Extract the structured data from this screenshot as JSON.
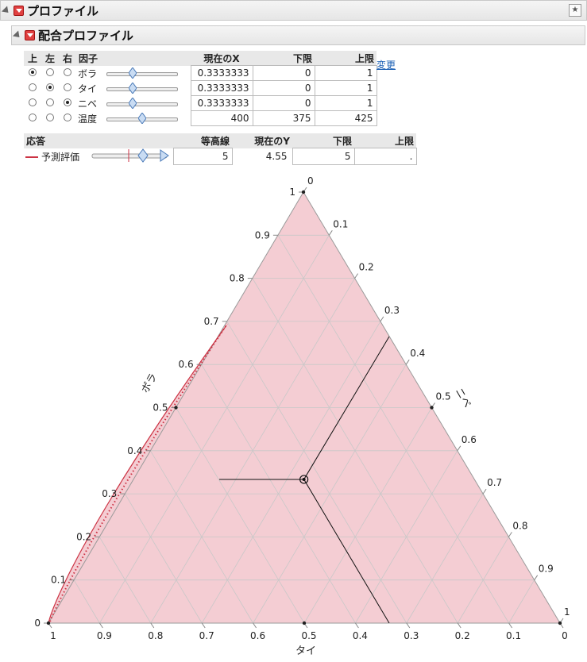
{
  "header_main": {
    "title": "プロファイル"
  },
  "header_sub": {
    "title": "配合プロファイル"
  },
  "factor_table": {
    "columns": [
      "上",
      "左",
      "右",
      "因子",
      "現在のX",
      "下限",
      "上限"
    ],
    "rows": [
      {
        "name": "ボラ",
        "current": "0.3333333",
        "low": "0",
        "high": "1",
        "top": true,
        "left": false,
        "right": false,
        "slider": 0.333
      },
      {
        "name": "タイ",
        "current": "0.3333333",
        "low": "0",
        "high": "1",
        "top": false,
        "left": true,
        "right": false,
        "slider": 0.333
      },
      {
        "name": "ニベ",
        "current": "0.3333333",
        "low": "0",
        "high": "1",
        "top": false,
        "left": false,
        "right": true,
        "slider": 0.333
      },
      {
        "name": "温度",
        "current": "400",
        "low": "375",
        "high": "425",
        "top": false,
        "left": false,
        "right": false,
        "slider": 0.5
      }
    ],
    "change_link": "変更"
  },
  "response_table": {
    "columns": [
      "応答",
      "等高線",
      "現在のY",
      "下限",
      "上限"
    ],
    "row": {
      "name": "予測評価",
      "contour": "5",
      "current_y": "4.55",
      "low": "5",
      "high": "."
    },
    "color": "#cc3344"
  },
  "ternary": {
    "top_axis_label": "ボラ",
    "right_axis_label": "ニベ",
    "bottom_axis_label": "タイ",
    "left_ticks": [
      "0",
      "0.1",
      "0.2",
      "0.3",
      "0.4",
      "0.5",
      "0.6",
      "0.7",
      "0.8",
      "0.9",
      "1"
    ],
    "right_ticks": [
      "0",
      "0.1",
      "0.2",
      "0.3",
      "0.4",
      "0.5",
      "0.6",
      "0.7",
      "0.8",
      "0.9",
      "1"
    ],
    "bottom_ticks": [
      "1",
      "0.9",
      "0.8",
      "0.7",
      "0.6",
      "0.5",
      "0.4",
      "0.3",
      "0.2",
      "0.1",
      "0"
    ],
    "current_point": {
      "bora": 0.3333,
      "tai": 0.3333,
      "nibe": 0.3333
    },
    "fill_color": "#f4cdd3",
    "contour_color": "#cc3344"
  }
}
